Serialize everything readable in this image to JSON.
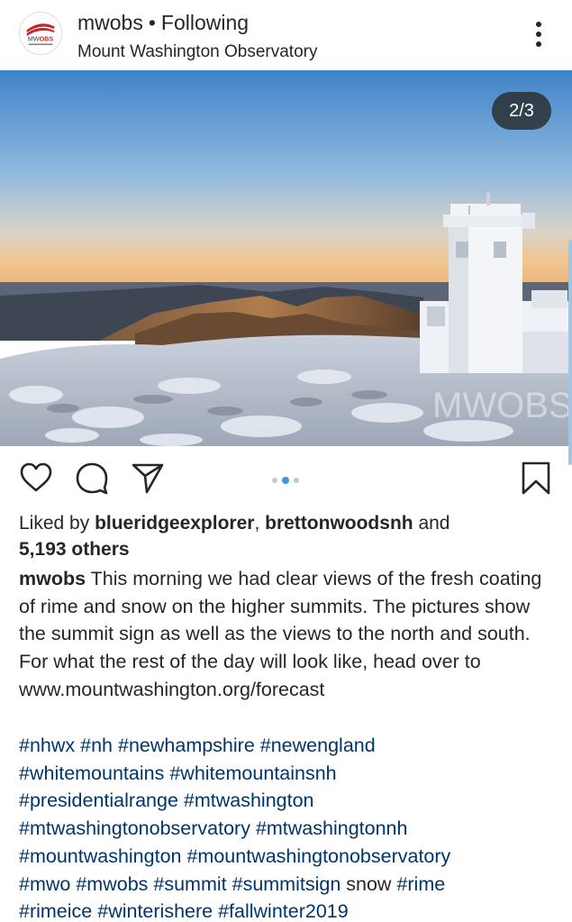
{
  "post": {
    "username": "mwobs",
    "separator": "•",
    "follow_status": "Following",
    "location": "Mount Washington Observatory",
    "avatar_icon": "mwobs-logo",
    "more_icon": "more-vertical-icon",
    "media_counter": "2/3",
    "carousel": {
      "total": 3,
      "current": 2
    },
    "watermark": "MWOBS MOUNT WASHINGTON"
  },
  "actions": {
    "like_icon": "heart-icon",
    "comment_icon": "comment-icon",
    "share_icon": "share-icon",
    "save_icon": "bookmark-icon"
  },
  "likes": {
    "prefix": "Liked by ",
    "user1": "blueridgeexplorer",
    "comma": ", ",
    "user2": "brettonwoodsnh",
    "and": " and",
    "others": "5,193 others"
  },
  "caption": {
    "author": "mwobs",
    "text": " This morning we had clear views of the fresh coating of rime and snow on the higher summits. The pictures show the summit sign as well as the views to the north and south. For what the rest of the day will look like, head over to www.mountwashington.org/forecast"
  },
  "tags": [
    "#nhwx",
    " ",
    "#nh",
    " ",
    "#newhampshire",
    " ",
    "#newengland",
    "\n",
    "#whitemountains",
    " ",
    "#whitemountainsnh",
    "\n",
    "#presidentialrange",
    " ",
    "#mtwashington",
    "\n",
    "#mtwashingtonobservatory",
    " ",
    "#mtwashingtonnh",
    "\n",
    "#mountwashington",
    " ",
    "#mountwashingtonobservatory",
    "\n",
    "#mwo",
    " ",
    "#mwobs",
    " ",
    "#summit",
    " ",
    "#summitsign",
    " snow ",
    "#rime",
    "\n",
    "#rimeice",
    " ",
    "#winterishere",
    " ",
    "#fallwinter2019"
  ],
  "colors": {
    "hashtag": "#003569",
    "dot_active": "#3897f0",
    "dot_inactive": "#c7c7c7"
  }
}
